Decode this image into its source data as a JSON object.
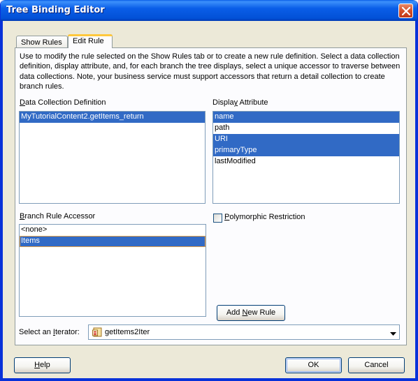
{
  "window": {
    "title": "Tree Binding Editor"
  },
  "tabs": [
    {
      "label": "Show Rules",
      "active": false
    },
    {
      "label": "Edit Rule",
      "active": true
    }
  ],
  "intro": "Use to modify the rule selected on the Show Rules tab or to create a new rule definition. Select a data collection definition, display attribute, and, for each branch the tree displays, select a unique accessor to traverse between data collections. Note, your business service must support accessors that return a detail collection to create branch rules.",
  "data_collection": {
    "label_pre": "",
    "label_mn": "D",
    "label_post": "ata Collection Definition",
    "items": [
      {
        "text": "MyTutorialContent2.getItems_return",
        "selected": true
      }
    ]
  },
  "display_attribute": {
    "label_pre": "Displa",
    "label_mn": "y",
    "label_post": " Attribute",
    "items": [
      {
        "text": "name",
        "selected": true
      },
      {
        "text": "path",
        "selected": false
      },
      {
        "text": "URI",
        "selected": true
      },
      {
        "text": "primaryType",
        "selected": true
      },
      {
        "text": "lastModified",
        "selected": false
      }
    ]
  },
  "branch_rule": {
    "label_pre": "",
    "label_mn": "B",
    "label_post": "ranch Rule Accessor",
    "items": [
      {
        "text": "<none>",
        "selected": false
      },
      {
        "text": "Items",
        "selected": true
      }
    ]
  },
  "polymorphic": {
    "label_pre": "",
    "label_mn": "P",
    "label_post": "olymorphic Restriction",
    "checked": false
  },
  "add_rule": {
    "label_pre": "Add ",
    "label_mn": "N",
    "label_post": "ew Rule"
  },
  "iterator": {
    "label_pre": "Select an ",
    "label_mn": "I",
    "label_post": "terator:",
    "value": "getItems2Iter",
    "icon": "iterator-icon"
  },
  "footer": {
    "help_pre": "",
    "help_mn": "H",
    "help_post": "elp",
    "ok": "OK",
    "cancel": "Cancel"
  }
}
